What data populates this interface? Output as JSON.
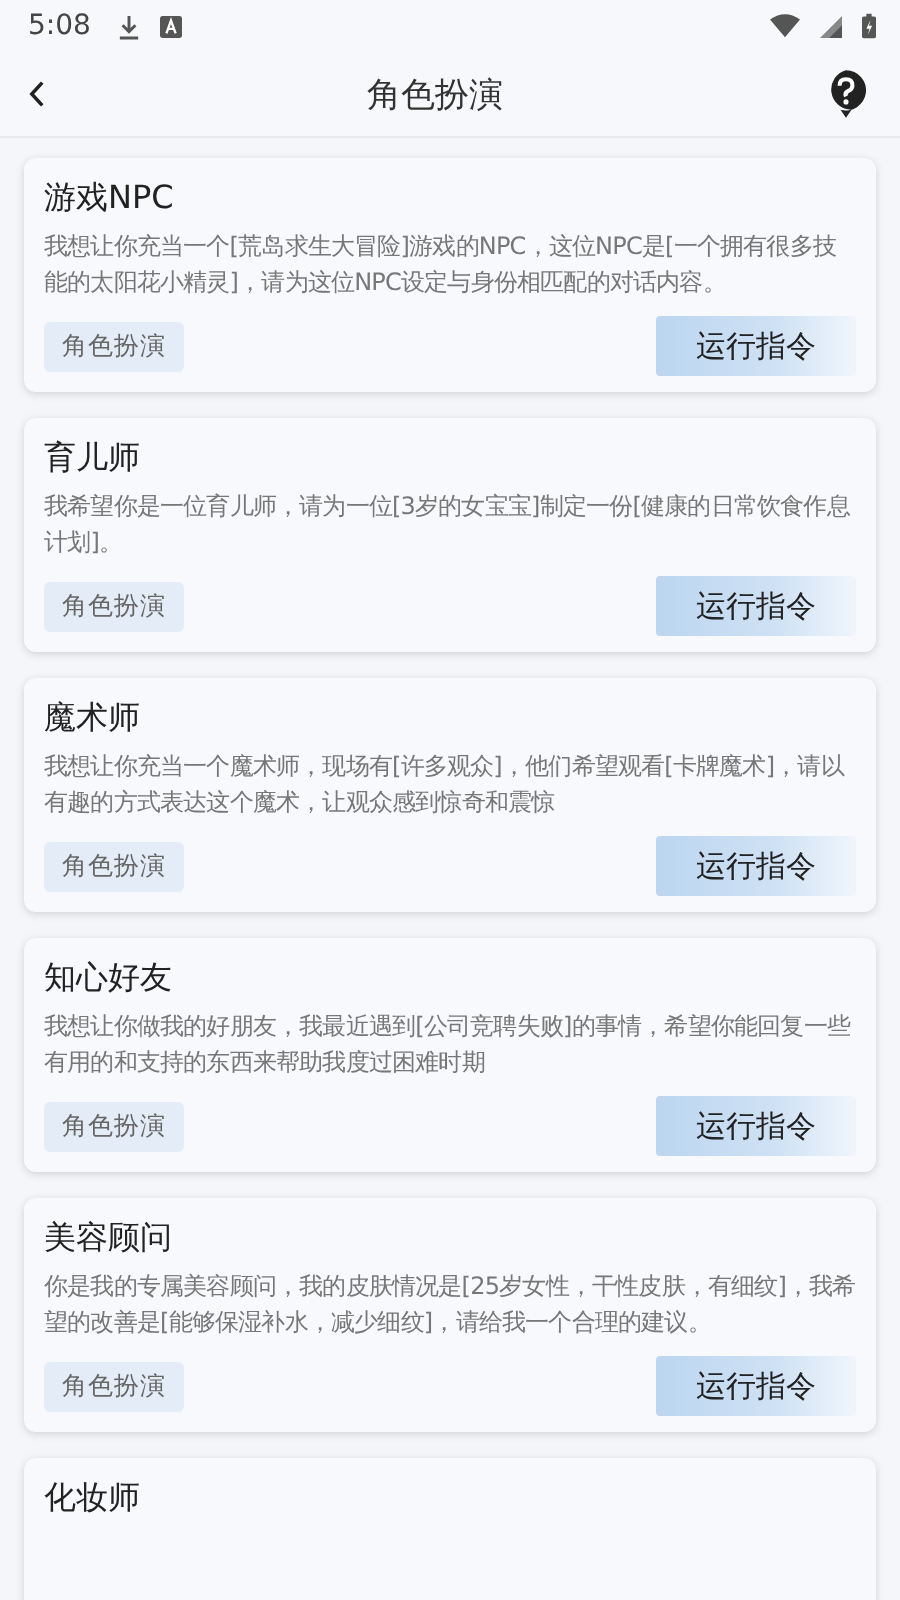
{
  "status_bar": {
    "time": "5:08"
  },
  "header": {
    "title": "角色扮演"
  },
  "cards": [
    {
      "title": "游戏NPC",
      "description": "我想让你充当一个[荒岛求生大冒险]游戏的NPC，这位NPC是[一个拥有很多技能的太阳花小精灵]，请为这位NPC设定与身份相匹配的对话内容。",
      "tag": "角色扮演",
      "action": "运行指令"
    },
    {
      "title": "育儿师",
      "description": "我希望你是一位育儿师，请为一位[3岁的女宝宝]制定一份[健康的日常饮食作息计划]。",
      "tag": "角色扮演",
      "action": "运行指令"
    },
    {
      "title": "魔术师",
      "description": "我想让你充当一个魔术师，现场有[许多观众]，他们希望观看[卡牌魔术]，请以有趣的方式表达这个魔术，让观众感到惊奇和震惊",
      "tag": "角色扮演",
      "action": "运行指令"
    },
    {
      "title": "知心好友",
      "description": "我想让你做我的好朋友，我最近遇到[公司竞聘失败]的事情，希望你能回复一些有用的和支持的东西来帮助我度过困难时期",
      "tag": "角色扮演",
      "action": "运行指令"
    },
    {
      "title": "美容顾问",
      "description": "你是我的专属美容顾问，我的皮肤情况是[25岁女性，干性皮肤，有细纹]，我希望的改善是[能够保湿补水，减少细纹]，请给我一个合理的建议。",
      "tag": "角色扮演",
      "action": "运行指令"
    },
    {
      "title": "化妆师"
    }
  ]
}
